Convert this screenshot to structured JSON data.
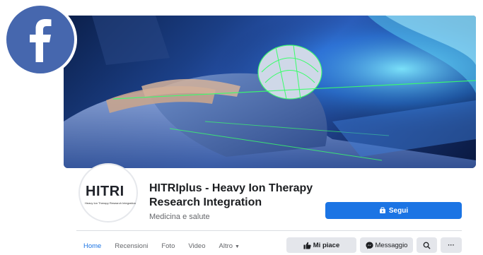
{
  "page": {
    "name": "HITRIplus - Heavy Ion Therapy Research Integration",
    "category": "Medicina e salute"
  },
  "avatar": {
    "logo_text": "HITRI",
    "tagline": "Heavy Ion Therapy Research Integration"
  },
  "badge": {
    "icon": "facebook-logo-icon"
  },
  "actions": {
    "follow_label": "Segui",
    "like_label": "Mi piace",
    "message_label": "Messaggio",
    "more_label": "···"
  },
  "tabs": [
    {
      "label": "Home",
      "active": true
    },
    {
      "label": "Recensioni"
    },
    {
      "label": "Foto"
    },
    {
      "label": "Video"
    },
    {
      "label": "Altro"
    }
  ],
  "colors": {
    "brand_blue": "#1b74e4",
    "badge_blue": "#4667ae",
    "laser_green": "#39ff6a"
  }
}
